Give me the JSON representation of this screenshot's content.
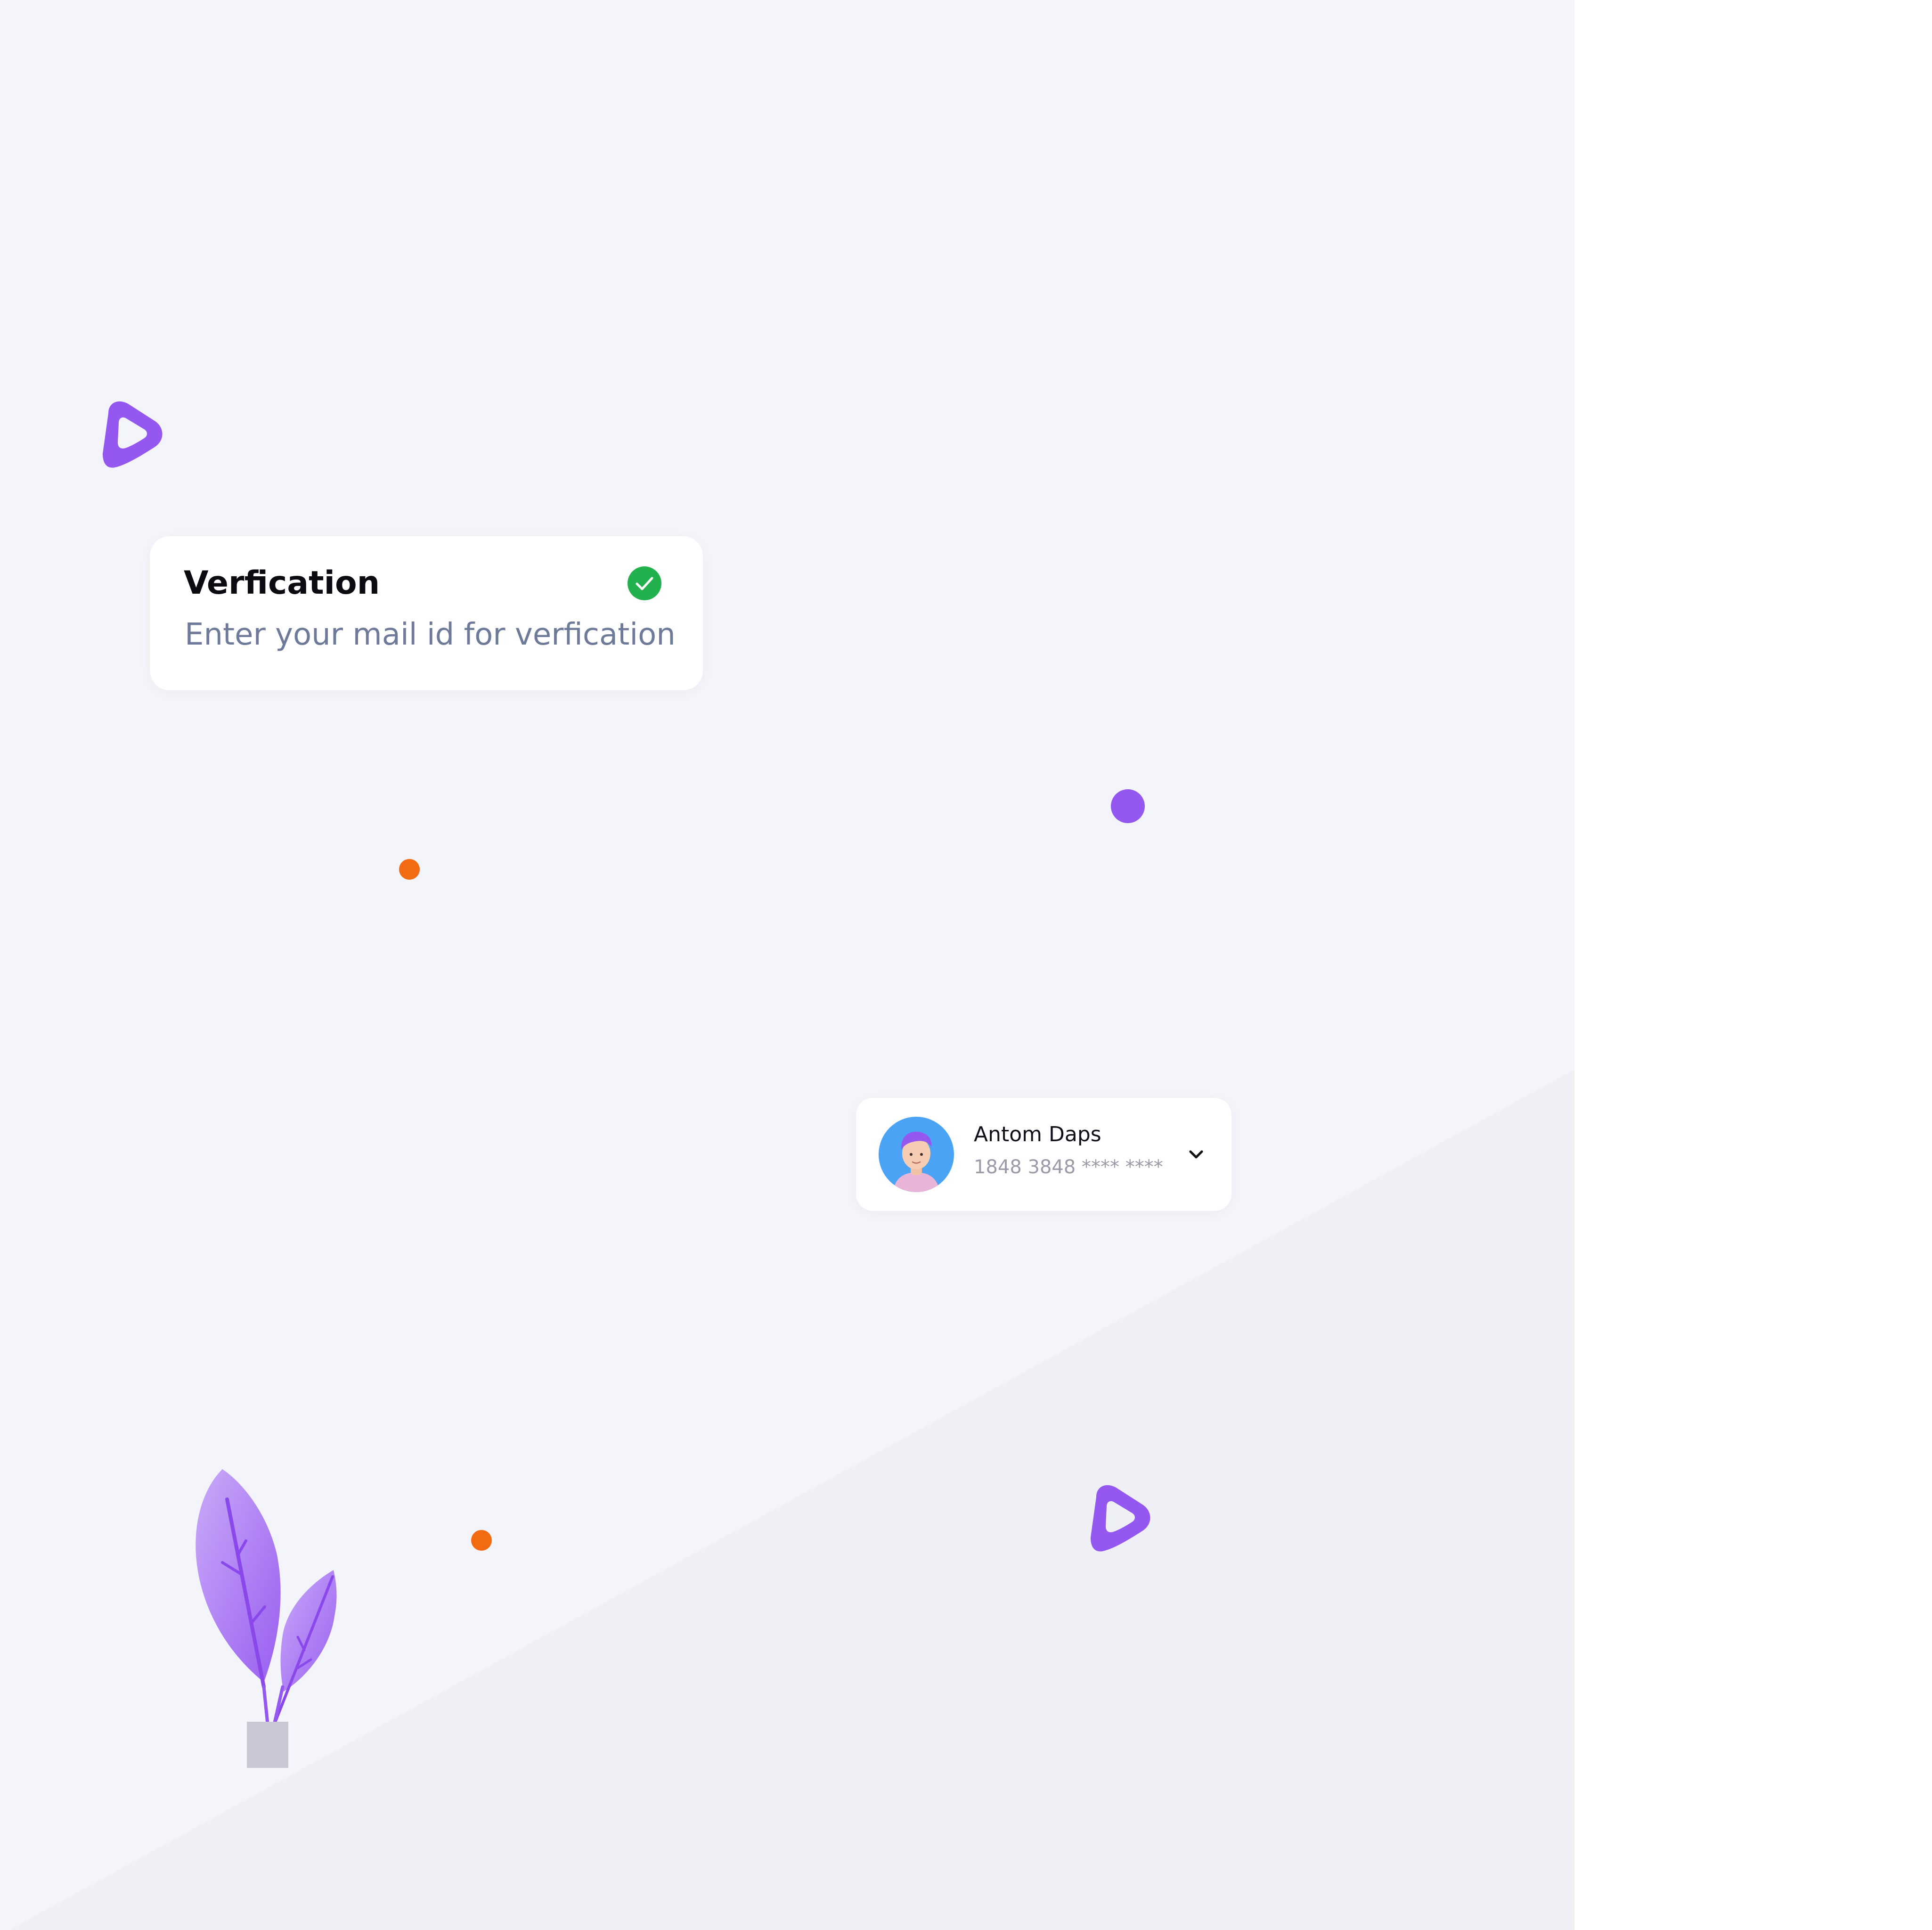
{
  "verification_card": {
    "title": "Verfication",
    "subtitle": "Enter your mail id for verfication",
    "status_icon": "check-circle-icon",
    "status_color": "#22b14c"
  },
  "account_card": {
    "name": "Antom Daps",
    "card_number": "1848 3848 **** ****",
    "avatar_icon": "user-avatar-icon",
    "dropdown_icon": "chevron-down-icon"
  },
  "decorations": {
    "accent_purple": "#9457f0",
    "accent_orange": "#f26a12",
    "background": "#f3f5fa",
    "plant_icon": "potted-plant-icon",
    "blob_icon": "rounded-triangle-icon"
  }
}
